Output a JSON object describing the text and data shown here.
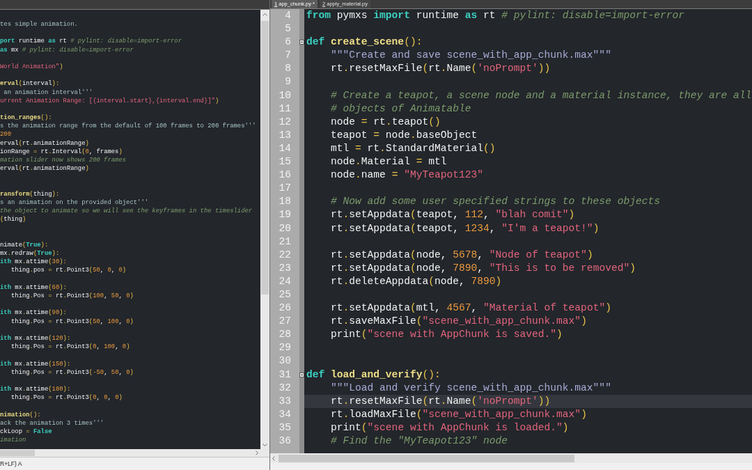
{
  "left_editor": {
    "lines": [
      {
        "kind": "code",
        "tokens": [
          {
            "kind": "triple_string",
            "text": "tes simple animation."
          }
        ]
      },
      {
        "kind": "blank"
      },
      {
        "kind": "code",
        "tokens": [
          {
            "kind": "keyword",
            "text": "port"
          },
          {
            "kind": "text",
            "text": " runtime "
          },
          {
            "kind": "keyword",
            "text": "as"
          },
          {
            "kind": "text",
            "text": " rt "
          },
          {
            "kind": "comment",
            "text": "# pylint: disable=import-error"
          }
        ]
      },
      {
        "kind": "code",
        "tokens": [
          {
            "kind": "keyword",
            "text": "as"
          },
          {
            "kind": "text",
            "text": " mx "
          },
          {
            "kind": "comment",
            "text": "# pylint: disable=import-error"
          }
        ]
      },
      {
        "kind": "blank"
      },
      {
        "kind": "code",
        "tokens": [
          {
            "kind": "string",
            "text": "World Animation\""
          },
          {
            "kind": "punct",
            "text": ")"
          }
        ]
      },
      {
        "kind": "blank"
      },
      {
        "kind": "code",
        "tokens": [
          {
            "kind": "function",
            "text": "erval"
          },
          {
            "kind": "punct",
            "text": "("
          },
          {
            "kind": "text",
            "text": "interval"
          },
          {
            "kind": "punct",
            "text": "):"
          }
        ]
      },
      {
        "kind": "code",
        "tokens": [
          {
            "kind": "triple_string",
            "text": " an animation interval'''"
          }
        ]
      },
      {
        "kind": "code",
        "tokens": [
          {
            "kind": "string",
            "text": "urrent Animation Range: [{interval.start},{interval.end}]\""
          },
          {
            "kind": "punct",
            "text": ")"
          }
        ]
      },
      {
        "kind": "blank"
      },
      {
        "kind": "code",
        "tokens": [
          {
            "kind": "function",
            "text": "tion_ranges"
          },
          {
            "kind": "punct",
            "text": "():"
          }
        ]
      },
      {
        "kind": "code",
        "tokens": [
          {
            "kind": "triple_string",
            "text": "s the animation range from the default of 100 frames to 200 frames'''"
          }
        ]
      },
      {
        "kind": "code",
        "tokens": [
          {
            "kind": "number",
            "text": "200"
          }
        ]
      },
      {
        "kind": "code",
        "tokens": [
          {
            "kind": "text",
            "text": "erval"
          },
          {
            "kind": "punct",
            "text": "("
          },
          {
            "kind": "text",
            "text": "rt"
          },
          {
            "kind": "punct",
            "text": "."
          },
          {
            "kind": "text",
            "text": "animationRange"
          },
          {
            "kind": "punct",
            "text": ")"
          }
        ]
      },
      {
        "kind": "code",
        "tokens": [
          {
            "kind": "text",
            "text": "ionRange "
          },
          {
            "kind": "punct",
            "text": "="
          },
          {
            "kind": "text",
            "text": " rt"
          },
          {
            "kind": "punct",
            "text": "."
          },
          {
            "kind": "text",
            "text": "Interval"
          },
          {
            "kind": "punct",
            "text": "("
          },
          {
            "kind": "number",
            "text": "0"
          },
          {
            "kind": "text",
            "text": ", frames"
          },
          {
            "kind": "punct",
            "text": ")"
          }
        ]
      },
      {
        "kind": "code",
        "tokens": [
          {
            "kind": "comment",
            "text": "mation slider now shows 200 frames"
          }
        ]
      },
      {
        "kind": "code",
        "tokens": [
          {
            "kind": "text",
            "text": "erval"
          },
          {
            "kind": "punct",
            "text": "("
          },
          {
            "kind": "text",
            "text": "rt"
          },
          {
            "kind": "punct",
            "text": "."
          },
          {
            "kind": "text",
            "text": "animationRange"
          },
          {
            "kind": "punct",
            "text": ")"
          }
        ]
      },
      {
        "kind": "blank"
      },
      {
        "kind": "blank"
      },
      {
        "kind": "code",
        "tokens": [
          {
            "kind": "function",
            "text": "ransform"
          },
          {
            "kind": "punct",
            "text": "("
          },
          {
            "kind": "text",
            "text": "thing"
          },
          {
            "kind": "punct",
            "text": "):"
          }
        ]
      },
      {
        "kind": "code",
        "tokens": [
          {
            "kind": "triple_string",
            "text": "s an animation on the provided object'''"
          }
        ]
      },
      {
        "kind": "code",
        "tokens": [
          {
            "kind": "comment",
            "text": "the object to animate so we will see the keyframes in the timeslider"
          }
        ]
      },
      {
        "kind": "code",
        "tokens": [
          {
            "kind": "punct",
            "text": "("
          },
          {
            "kind": "text",
            "text": "thing"
          },
          {
            "kind": "punct",
            "text": ")"
          }
        ]
      },
      {
        "kind": "blank"
      },
      {
        "kind": "blank"
      },
      {
        "kind": "code",
        "tokens": [
          {
            "kind": "text",
            "text": "nimate"
          },
          {
            "kind": "punct",
            "text": "("
          },
          {
            "kind": "keyword",
            "text": "True"
          },
          {
            "kind": "punct",
            "text": "):"
          }
        ]
      },
      {
        "kind": "code",
        "tokens": [
          {
            "kind": "text",
            "text": "mx"
          },
          {
            "kind": "punct",
            "text": "."
          },
          {
            "kind": "text",
            "text": "redraw"
          },
          {
            "kind": "punct",
            "text": "("
          },
          {
            "kind": "keyword",
            "text": "True"
          },
          {
            "kind": "punct",
            "text": "):"
          }
        ]
      },
      {
        "kind": "code",
        "tokens": [
          {
            "kind": "keyword",
            "text": "ith"
          },
          {
            "kind": "text",
            "text": " mx"
          },
          {
            "kind": "punct",
            "text": "."
          },
          {
            "kind": "text",
            "text": "attime"
          },
          {
            "kind": "punct",
            "text": "("
          },
          {
            "kind": "number",
            "text": "30"
          },
          {
            "kind": "punct",
            "text": "):"
          }
        ]
      },
      {
        "kind": "code",
        "tokens": [
          {
            "kind": "text",
            "text": "   thing"
          },
          {
            "kind": "punct",
            "text": "."
          },
          {
            "kind": "text",
            "text": "pos "
          },
          {
            "kind": "punct",
            "text": "="
          },
          {
            "kind": "text",
            "text": " rt"
          },
          {
            "kind": "punct",
            "text": "."
          },
          {
            "kind": "text",
            "text": "Point3"
          },
          {
            "kind": "punct",
            "text": "("
          },
          {
            "kind": "number",
            "text": "50"
          },
          {
            "kind": "text",
            "text": ", "
          },
          {
            "kind": "number",
            "text": "0"
          },
          {
            "kind": "text",
            "text": ", "
          },
          {
            "kind": "number",
            "text": "0"
          },
          {
            "kind": "punct",
            "text": ")"
          }
        ]
      },
      {
        "kind": "blank"
      },
      {
        "kind": "code",
        "tokens": [
          {
            "kind": "keyword",
            "text": "ith"
          },
          {
            "kind": "text",
            "text": " mx"
          },
          {
            "kind": "punct",
            "text": "."
          },
          {
            "kind": "text",
            "text": "attime"
          },
          {
            "kind": "punct",
            "text": "("
          },
          {
            "kind": "number",
            "text": "60"
          },
          {
            "kind": "punct",
            "text": "):"
          }
        ]
      },
      {
        "kind": "code",
        "tokens": [
          {
            "kind": "text",
            "text": "   thing"
          },
          {
            "kind": "punct",
            "text": "."
          },
          {
            "kind": "text",
            "text": "Pos "
          },
          {
            "kind": "punct",
            "text": "="
          },
          {
            "kind": "text",
            "text": " rt"
          },
          {
            "kind": "punct",
            "text": "."
          },
          {
            "kind": "text",
            "text": "Point3"
          },
          {
            "kind": "punct",
            "text": "("
          },
          {
            "kind": "number",
            "text": "100"
          },
          {
            "kind": "text",
            "text": ", "
          },
          {
            "kind": "number",
            "text": "50"
          },
          {
            "kind": "text",
            "text": ", "
          },
          {
            "kind": "number",
            "text": "0"
          },
          {
            "kind": "punct",
            "text": ")"
          }
        ]
      },
      {
        "kind": "blank"
      },
      {
        "kind": "code",
        "tokens": [
          {
            "kind": "keyword",
            "text": "ith"
          },
          {
            "kind": "text",
            "text": " mx"
          },
          {
            "kind": "punct",
            "text": "."
          },
          {
            "kind": "text",
            "text": "attime"
          },
          {
            "kind": "punct",
            "text": "("
          },
          {
            "kind": "number",
            "text": "90"
          },
          {
            "kind": "punct",
            "text": "):"
          }
        ]
      },
      {
        "kind": "code",
        "tokens": [
          {
            "kind": "text",
            "text": "   thing"
          },
          {
            "kind": "punct",
            "text": "."
          },
          {
            "kind": "text",
            "text": "Pos "
          },
          {
            "kind": "punct",
            "text": "="
          },
          {
            "kind": "text",
            "text": " rt"
          },
          {
            "kind": "punct",
            "text": "."
          },
          {
            "kind": "text",
            "text": "Point3"
          },
          {
            "kind": "punct",
            "text": "("
          },
          {
            "kind": "number",
            "text": "50"
          },
          {
            "kind": "text",
            "text": ", "
          },
          {
            "kind": "number",
            "text": "100"
          },
          {
            "kind": "text",
            "text": ", "
          },
          {
            "kind": "number",
            "text": "0"
          },
          {
            "kind": "punct",
            "text": ")"
          }
        ]
      },
      {
        "kind": "blank"
      },
      {
        "kind": "code",
        "tokens": [
          {
            "kind": "keyword",
            "text": "ith"
          },
          {
            "kind": "text",
            "text": " mx"
          },
          {
            "kind": "punct",
            "text": "."
          },
          {
            "kind": "text",
            "text": "attime"
          },
          {
            "kind": "punct",
            "text": "("
          },
          {
            "kind": "number",
            "text": "120"
          },
          {
            "kind": "punct",
            "text": "):"
          }
        ]
      },
      {
        "kind": "code",
        "tokens": [
          {
            "kind": "text",
            "text": "   thing"
          },
          {
            "kind": "punct",
            "text": "."
          },
          {
            "kind": "text",
            "text": "Pos "
          },
          {
            "kind": "punct",
            "text": "="
          },
          {
            "kind": "text",
            "text": " rt"
          },
          {
            "kind": "punct",
            "text": "."
          },
          {
            "kind": "text",
            "text": "Point3"
          },
          {
            "kind": "punct",
            "text": "("
          },
          {
            "kind": "number",
            "text": "0"
          },
          {
            "kind": "text",
            "text": ", "
          },
          {
            "kind": "number",
            "text": "100"
          },
          {
            "kind": "text",
            "text": ", "
          },
          {
            "kind": "number",
            "text": "0"
          },
          {
            "kind": "punct",
            "text": ")"
          }
        ]
      },
      {
        "kind": "blank"
      },
      {
        "kind": "code",
        "tokens": [
          {
            "kind": "keyword",
            "text": "ith"
          },
          {
            "kind": "text",
            "text": " mx"
          },
          {
            "kind": "punct",
            "text": "."
          },
          {
            "kind": "text",
            "text": "attime"
          },
          {
            "kind": "punct",
            "text": "("
          },
          {
            "kind": "number",
            "text": "150"
          },
          {
            "kind": "punct",
            "text": "):"
          }
        ]
      },
      {
        "kind": "code",
        "tokens": [
          {
            "kind": "text",
            "text": "   thing"
          },
          {
            "kind": "punct",
            "text": "."
          },
          {
            "kind": "text",
            "text": "Pos "
          },
          {
            "kind": "punct",
            "text": "="
          },
          {
            "kind": "text",
            "text": " rt"
          },
          {
            "kind": "punct",
            "text": "."
          },
          {
            "kind": "text",
            "text": "Point3"
          },
          {
            "kind": "punct",
            "text": "("
          },
          {
            "kind": "number",
            "text": "-50"
          },
          {
            "kind": "text",
            "text": ", "
          },
          {
            "kind": "number",
            "text": "50"
          },
          {
            "kind": "text",
            "text": ", "
          },
          {
            "kind": "number",
            "text": "0"
          },
          {
            "kind": "punct",
            "text": ")"
          }
        ]
      },
      {
        "kind": "blank"
      },
      {
        "kind": "code",
        "tokens": [
          {
            "kind": "keyword",
            "text": "ith"
          },
          {
            "kind": "text",
            "text": " mx"
          },
          {
            "kind": "punct",
            "text": "."
          },
          {
            "kind": "text",
            "text": "attime"
          },
          {
            "kind": "punct",
            "text": "("
          },
          {
            "kind": "number",
            "text": "180"
          },
          {
            "kind": "punct",
            "text": "):"
          }
        ]
      },
      {
        "kind": "code",
        "tokens": [
          {
            "kind": "text",
            "text": "   thing"
          },
          {
            "kind": "punct",
            "text": "."
          },
          {
            "kind": "text",
            "text": "Pos "
          },
          {
            "kind": "punct",
            "text": "="
          },
          {
            "kind": "text",
            "text": " rt"
          },
          {
            "kind": "punct",
            "text": "."
          },
          {
            "kind": "text",
            "text": "Point3"
          },
          {
            "kind": "punct",
            "text": "("
          },
          {
            "kind": "number",
            "text": "0"
          },
          {
            "kind": "text",
            "text": ", "
          },
          {
            "kind": "number",
            "text": "0"
          },
          {
            "kind": "text",
            "text": ", "
          },
          {
            "kind": "number",
            "text": "0"
          },
          {
            "kind": "punct",
            "text": ")"
          }
        ]
      },
      {
        "kind": "blank"
      },
      {
        "kind": "code",
        "tokens": [
          {
            "kind": "function",
            "text": "nimation"
          },
          {
            "kind": "punct",
            "text": "():"
          }
        ]
      },
      {
        "kind": "code",
        "tokens": [
          {
            "kind": "triple_string",
            "text": "ack the animation 3 times'''"
          }
        ]
      },
      {
        "kind": "code",
        "tokens": [
          {
            "kind": "text",
            "text": "ckLoop "
          },
          {
            "kind": "punct",
            "text": "="
          },
          {
            "kind": "keyword",
            "text": " False"
          }
        ]
      },
      {
        "kind": "code",
        "tokens": [
          {
            "kind": "comment",
            "text": "imation"
          }
        ]
      }
    ]
  },
  "tabs": [
    {
      "label": "1 app_chunk.py *",
      "selected": true
    },
    {
      "label": "2 apply_material.py",
      "selected": false
    }
  ],
  "right_editor": {
    "lines": [
      {
        "kind": "line",
        "number": "4",
        "current": false,
        "tokens": [
          {
            "kind": "keyword",
            "text": "from"
          },
          {
            "kind": "text",
            "text": " pymxs "
          },
          {
            "kind": "keyword",
            "text": "import"
          },
          {
            "kind": "text",
            "text": " runtime "
          },
          {
            "kind": "keyword",
            "text": "as"
          },
          {
            "kind": "text",
            "text": " rt "
          },
          {
            "kind": "comment",
            "text": "# pylint: disable=import-error"
          }
        ]
      },
      {
        "kind": "line",
        "number": "5",
        "current": false
      },
      {
        "kind": "fold_start",
        "number": "6",
        "current": false,
        "tokens": [
          {
            "kind": "keyword",
            "text": "def "
          },
          {
            "kind": "function",
            "text": "create_scene"
          },
          {
            "kind": "punct",
            "text": "():"
          }
        ]
      },
      {
        "kind": "line",
        "number": "7",
        "current": false,
        "tokens": [
          {
            "kind": "docstring",
            "text": "    \"\"\"Create and save scene_with_app_chunk.max\"\"\""
          }
        ]
      },
      {
        "kind": "line",
        "number": "8",
        "current": false,
        "tokens": [
          {
            "kind": "text",
            "text": "    rt"
          },
          {
            "kind": "punct",
            "text": "."
          },
          {
            "kind": "text",
            "text": "resetMaxFile"
          },
          {
            "kind": "punct",
            "text": "("
          },
          {
            "kind": "text",
            "text": "rt"
          },
          {
            "kind": "punct",
            "text": "."
          },
          {
            "kind": "text",
            "text": "Name"
          },
          {
            "kind": "punct",
            "text": "("
          },
          {
            "kind": "string",
            "text": "'noPrompt'"
          },
          {
            "kind": "punct",
            "text": "))"
          }
        ]
      },
      {
        "kind": "line",
        "number": "9",
        "current": false
      },
      {
        "kind": "line",
        "number": "10",
        "current": false,
        "tokens": [
          {
            "kind": "comment",
            "text": "    # Create a teapot, a scene node and a material instance, they are all"
          }
        ]
      },
      {
        "kind": "line",
        "number": "11",
        "current": false,
        "tokens": [
          {
            "kind": "comment",
            "text": "    # objects of Animatable"
          }
        ]
      },
      {
        "kind": "line",
        "number": "12",
        "current": false,
        "tokens": [
          {
            "kind": "text",
            "text": "    node "
          },
          {
            "kind": "punct",
            "text": "="
          },
          {
            "kind": "text",
            "text": " rt"
          },
          {
            "kind": "punct",
            "text": "."
          },
          {
            "kind": "text",
            "text": "teapot"
          },
          {
            "kind": "punct",
            "text": "()"
          }
        ]
      },
      {
        "kind": "line",
        "number": "13",
        "current": false,
        "tokens": [
          {
            "kind": "text",
            "text": "    teapot "
          },
          {
            "kind": "punct",
            "text": "="
          },
          {
            "kind": "text",
            "text": " node"
          },
          {
            "kind": "punct",
            "text": "."
          },
          {
            "kind": "text",
            "text": "baseObject"
          }
        ]
      },
      {
        "kind": "line",
        "number": "14",
        "current": false,
        "tokens": [
          {
            "kind": "text",
            "text": "    mtl "
          },
          {
            "kind": "punct",
            "text": "="
          },
          {
            "kind": "text",
            "text": " rt"
          },
          {
            "kind": "punct",
            "text": "."
          },
          {
            "kind": "text",
            "text": "StandardMaterial"
          },
          {
            "kind": "punct",
            "text": "()"
          }
        ]
      },
      {
        "kind": "line",
        "number": "15",
        "current": false,
        "tokens": [
          {
            "kind": "text",
            "text": "    node"
          },
          {
            "kind": "punct",
            "text": "."
          },
          {
            "kind": "text",
            "text": "Material "
          },
          {
            "kind": "punct",
            "text": "="
          },
          {
            "kind": "text",
            "text": " mtl"
          }
        ]
      },
      {
        "kind": "line",
        "number": "16",
        "current": false,
        "tokens": [
          {
            "kind": "text",
            "text": "    node"
          },
          {
            "kind": "punct",
            "text": "."
          },
          {
            "kind": "text",
            "text": "name "
          },
          {
            "kind": "punct",
            "text": "="
          },
          {
            "kind": "string",
            "text": " \"MyTeapot123\""
          }
        ]
      },
      {
        "kind": "line",
        "number": "17",
        "current": false
      },
      {
        "kind": "line",
        "number": "18",
        "current": false,
        "tokens": [
          {
            "kind": "comment",
            "text": "    # Now add some user specified strings to these objects"
          }
        ]
      },
      {
        "kind": "line",
        "number": "19",
        "current": false,
        "tokens": [
          {
            "kind": "text",
            "text": "    rt"
          },
          {
            "kind": "punct",
            "text": "."
          },
          {
            "kind": "text",
            "text": "setAppdata"
          },
          {
            "kind": "punct",
            "text": "("
          },
          {
            "kind": "text",
            "text": "teapot, "
          },
          {
            "kind": "number",
            "text": "112"
          },
          {
            "kind": "text",
            "text": ", "
          },
          {
            "kind": "string",
            "text": "\"blah comit\""
          },
          {
            "kind": "punct",
            "text": ")"
          }
        ]
      },
      {
        "kind": "line",
        "number": "20",
        "current": false,
        "tokens": [
          {
            "kind": "text",
            "text": "    rt"
          },
          {
            "kind": "punct",
            "text": "."
          },
          {
            "kind": "text",
            "text": "setAppdata"
          },
          {
            "kind": "punct",
            "text": "("
          },
          {
            "kind": "text",
            "text": "teapot, "
          },
          {
            "kind": "number",
            "text": "1234"
          },
          {
            "kind": "text",
            "text": ", "
          },
          {
            "kind": "string",
            "text": "\"I'm a teapot!\""
          },
          {
            "kind": "punct",
            "text": ")"
          }
        ]
      },
      {
        "kind": "line",
        "number": "21",
        "current": false
      },
      {
        "kind": "line",
        "number": "22",
        "current": false,
        "tokens": [
          {
            "kind": "text",
            "text": "    rt"
          },
          {
            "kind": "punct",
            "text": "."
          },
          {
            "kind": "text",
            "text": "setAppdata"
          },
          {
            "kind": "punct",
            "text": "("
          },
          {
            "kind": "text",
            "text": "node, "
          },
          {
            "kind": "number",
            "text": "5678"
          },
          {
            "kind": "text",
            "text": ", "
          },
          {
            "kind": "string",
            "text": "\"Node of teapot\""
          },
          {
            "kind": "punct",
            "text": ")"
          }
        ]
      },
      {
        "kind": "line",
        "number": "23",
        "current": false,
        "tokens": [
          {
            "kind": "text",
            "text": "    rt"
          },
          {
            "kind": "punct",
            "text": "."
          },
          {
            "kind": "text",
            "text": "setAppdata"
          },
          {
            "kind": "punct",
            "text": "("
          },
          {
            "kind": "text",
            "text": "node, "
          },
          {
            "kind": "number",
            "text": "7890"
          },
          {
            "kind": "text",
            "text": ", "
          },
          {
            "kind": "string",
            "text": "\"This is to be removed\""
          },
          {
            "kind": "punct",
            "text": ")"
          }
        ]
      },
      {
        "kind": "line",
        "number": "24",
        "current": false,
        "tokens": [
          {
            "kind": "text",
            "text": "    rt"
          },
          {
            "kind": "punct",
            "text": "."
          },
          {
            "kind": "text",
            "text": "deleteAppdata"
          },
          {
            "kind": "punct",
            "text": "("
          },
          {
            "kind": "text",
            "text": "node, "
          },
          {
            "kind": "number",
            "text": "7890"
          },
          {
            "kind": "punct",
            "text": ")"
          }
        ]
      },
      {
        "kind": "line",
        "number": "25",
        "current": false
      },
      {
        "kind": "line",
        "number": "26",
        "current": false,
        "tokens": [
          {
            "kind": "text",
            "text": "    rt"
          },
          {
            "kind": "punct",
            "text": "."
          },
          {
            "kind": "text",
            "text": "setAppdata"
          },
          {
            "kind": "punct",
            "text": "("
          },
          {
            "kind": "text",
            "text": "mtl, "
          },
          {
            "kind": "number",
            "text": "4567"
          },
          {
            "kind": "text",
            "text": ", "
          },
          {
            "kind": "string",
            "text": "\"Material of teapot\""
          },
          {
            "kind": "punct",
            "text": ")"
          }
        ]
      },
      {
        "kind": "line",
        "number": "27",
        "current": false,
        "tokens": [
          {
            "kind": "text",
            "text": "    rt"
          },
          {
            "kind": "punct",
            "text": "."
          },
          {
            "kind": "text",
            "text": "saveMaxFile"
          },
          {
            "kind": "punct",
            "text": "("
          },
          {
            "kind": "string",
            "text": "\"scene_with_app_chunk.max\""
          },
          {
            "kind": "punct",
            "text": ")"
          }
        ]
      },
      {
        "kind": "line",
        "number": "28",
        "current": false,
        "tokens": [
          {
            "kind": "text",
            "text": "    print"
          },
          {
            "kind": "punct",
            "text": "("
          },
          {
            "kind": "string",
            "text": "\"scene with AppChunk is saved.\""
          },
          {
            "kind": "punct",
            "text": ")"
          }
        ]
      },
      {
        "kind": "line",
        "number": "29",
        "current": false
      },
      {
        "kind": "line",
        "number": "30",
        "current": false
      },
      {
        "kind": "fold_start",
        "number": "31",
        "current": false,
        "tokens": [
          {
            "kind": "keyword",
            "text": "def "
          },
          {
            "kind": "function",
            "text": "load_and_verify"
          },
          {
            "kind": "punct",
            "text": "():"
          }
        ]
      },
      {
        "kind": "line",
        "number": "32",
        "current": false,
        "tokens": [
          {
            "kind": "docstring",
            "text": "    \"\"\"Load and verify scene_with_app_chunk.max\"\"\""
          }
        ]
      },
      {
        "kind": "line",
        "number": "33",
        "current": true,
        "tokens": [
          {
            "kind": "text",
            "text": "    rt"
          },
          {
            "kind": "punct",
            "text": "."
          },
          {
            "kind": "text",
            "text": "resetMaxFile"
          },
          {
            "kind": "punct",
            "text": "("
          },
          {
            "kind": "text",
            "text": "rt"
          },
          {
            "kind": "punct",
            "text": "."
          },
          {
            "kind": "text",
            "text": "Name"
          },
          {
            "kind": "punct",
            "text": "("
          },
          {
            "kind": "string",
            "text": "'noPrompt'"
          },
          {
            "kind": "punct",
            "text": "))"
          }
        ]
      },
      {
        "kind": "line",
        "number": "34",
        "current": false,
        "tokens": [
          {
            "kind": "text",
            "text": "    rt"
          },
          {
            "kind": "punct",
            "text": "."
          },
          {
            "kind": "text",
            "text": "loadMaxFile"
          },
          {
            "kind": "punct",
            "text": "("
          },
          {
            "kind": "string",
            "text": "\"scene_with_app_chunk.max\""
          },
          {
            "kind": "punct",
            "text": ")"
          }
        ]
      },
      {
        "kind": "line",
        "number": "35",
        "current": false,
        "tokens": [
          {
            "kind": "text",
            "text": "    print"
          },
          {
            "kind": "punct",
            "text": "("
          },
          {
            "kind": "string",
            "text": "\"scene with AppChunk is loaded.\""
          },
          {
            "kind": "punct",
            "text": ")"
          }
        ]
      },
      {
        "kind": "line",
        "number": "36",
        "current": false,
        "tokens": [
          {
            "kind": "comment",
            "text": "    # Find the \"MyTeapot123\" node"
          }
        ]
      }
    ]
  },
  "status_bar": {
    "text": "R+LF) A"
  }
}
